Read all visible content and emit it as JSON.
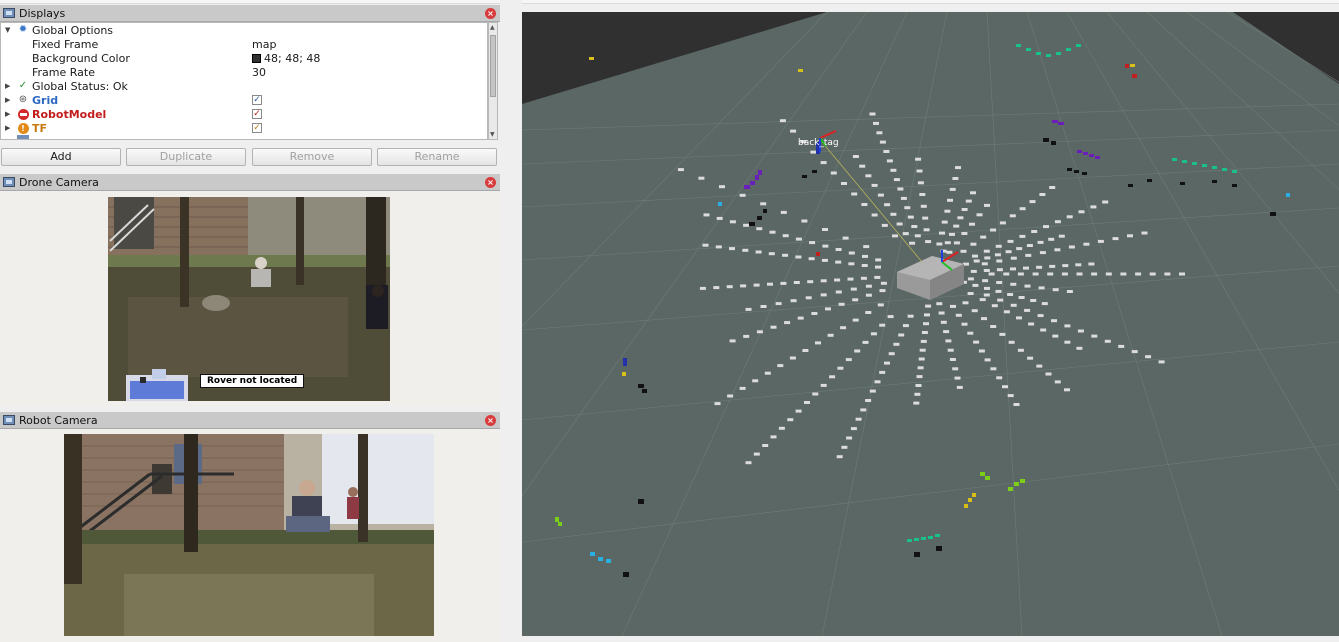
{
  "displays_panel": {
    "title": "Displays",
    "tree": [
      {
        "label": "Global Options",
        "value": ""
      },
      {
        "label": "Fixed Frame",
        "value": "map"
      },
      {
        "label": "Background Color",
        "value": "48; 48; 48"
      },
      {
        "label": "Frame Rate",
        "value": "30"
      },
      {
        "label": "Global Status: Ok",
        "value": ""
      },
      {
        "label": "Grid",
        "checked": true
      },
      {
        "label": "RobotModel",
        "checked": true
      },
      {
        "label": "TF",
        "checked": true
      }
    ],
    "buttons": {
      "add": "Add",
      "duplicate": "Duplicate",
      "remove": "Remove",
      "rename": "Rename"
    }
  },
  "drone_camera": {
    "title": "Drone Camera",
    "overlay_text": "Rover not located"
  },
  "robot_camera": {
    "title": "Robot Camera"
  },
  "viewport": {
    "tf_label": "back_tag",
    "background_color": "#303030",
    "grid_color": "#5e6b68"
  }
}
